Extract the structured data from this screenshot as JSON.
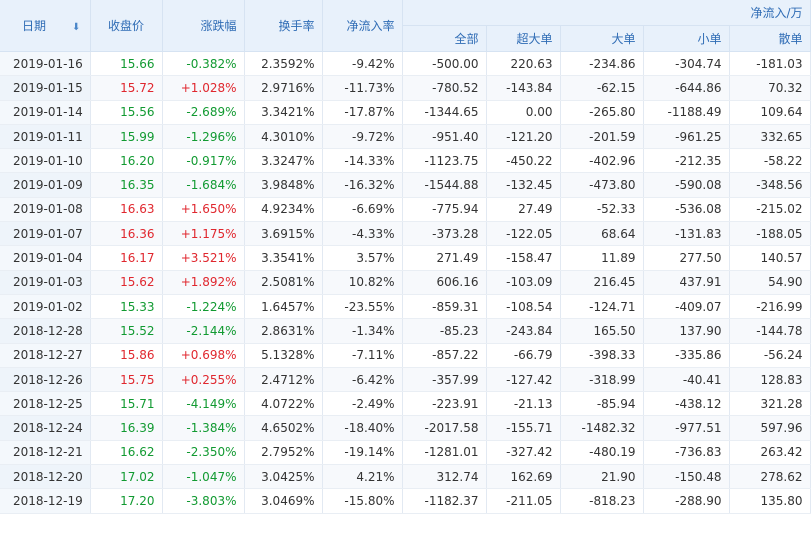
{
  "headers": {
    "date": "日期",
    "close": "收盘价",
    "change": "涨跌幅",
    "turnover": "换手率",
    "net_rate": "净流入率",
    "net_group": "净流入/万",
    "total": "全部",
    "super_large": "超大单",
    "large": "大单",
    "small": "小单",
    "retail": "散单",
    "sort_icon": "arrow-down-icon"
  },
  "colors": {
    "up": "#e0272e",
    "down": "#119a31",
    "header_bg": "#e8f1fb",
    "header_text": "#2f6cb5"
  },
  "rows": [
    {
      "date": "2019-01-16",
      "close": "15.66",
      "change": "-0.382%",
      "turnover": "2.3592%",
      "net_rate": "-9.42%",
      "total": "-500.00",
      "super_large": "220.63",
      "large": "-234.86",
      "small": "-304.74",
      "retail": "-181.03",
      "dir": "down"
    },
    {
      "date": "2019-01-15",
      "close": "15.72",
      "change": "+1.028%",
      "turnover": "2.9716%",
      "net_rate": "-11.73%",
      "total": "-780.52",
      "super_large": "-143.84",
      "large": "-62.15",
      "small": "-644.86",
      "retail": "70.32",
      "dir": "up"
    },
    {
      "date": "2019-01-14",
      "close": "15.56",
      "change": "-2.689%",
      "turnover": "3.3421%",
      "net_rate": "-17.87%",
      "total": "-1344.65",
      "super_large": "0.00",
      "large": "-265.80",
      "small": "-1188.49",
      "retail": "109.64",
      "dir": "down"
    },
    {
      "date": "2019-01-11",
      "close": "15.99",
      "change": "-1.296%",
      "turnover": "4.3010%",
      "net_rate": "-9.72%",
      "total": "-951.40",
      "super_large": "-121.20",
      "large": "-201.59",
      "small": "-961.25",
      "retail": "332.65",
      "dir": "down"
    },
    {
      "date": "2019-01-10",
      "close": "16.20",
      "change": "-0.917%",
      "turnover": "3.3247%",
      "net_rate": "-14.33%",
      "total": "-1123.75",
      "super_large": "-450.22",
      "large": "-402.96",
      "small": "-212.35",
      "retail": "-58.22",
      "dir": "down"
    },
    {
      "date": "2019-01-09",
      "close": "16.35",
      "change": "-1.684%",
      "turnover": "3.9848%",
      "net_rate": "-16.32%",
      "total": "-1544.88",
      "super_large": "-132.45",
      "large": "-473.80",
      "small": "-590.08",
      "retail": "-348.56",
      "dir": "down"
    },
    {
      "date": "2019-01-08",
      "close": "16.63",
      "change": "+1.650%",
      "turnover": "4.9234%",
      "net_rate": "-6.69%",
      "total": "-775.94",
      "super_large": "27.49",
      "large": "-52.33",
      "small": "-536.08",
      "retail": "-215.02",
      "dir": "up"
    },
    {
      "date": "2019-01-07",
      "close": "16.36",
      "change": "+1.175%",
      "turnover": "3.6915%",
      "net_rate": "-4.33%",
      "total": "-373.28",
      "super_large": "-122.05",
      "large": "68.64",
      "small": "-131.83",
      "retail": "-188.05",
      "dir": "up"
    },
    {
      "date": "2019-01-04",
      "close": "16.17",
      "change": "+3.521%",
      "turnover": "3.3541%",
      "net_rate": "3.57%",
      "total": "271.49",
      "super_large": "-158.47",
      "large": "11.89",
      "small": "277.50",
      "retail": "140.57",
      "dir": "up"
    },
    {
      "date": "2019-01-03",
      "close": "15.62",
      "change": "+1.892%",
      "turnover": "2.5081%",
      "net_rate": "10.82%",
      "total": "606.16",
      "super_large": "-103.09",
      "large": "216.45",
      "small": "437.91",
      "retail": "54.90",
      "dir": "up"
    },
    {
      "date": "2019-01-02",
      "close": "15.33",
      "change": "-1.224%",
      "turnover": "1.6457%",
      "net_rate": "-23.55%",
      "total": "-859.31",
      "super_large": "-108.54",
      "large": "-124.71",
      "small": "-409.07",
      "retail": "-216.99",
      "dir": "down"
    },
    {
      "date": "2018-12-28",
      "close": "15.52",
      "change": "-2.144%",
      "turnover": "2.8631%",
      "net_rate": "-1.34%",
      "total": "-85.23",
      "super_large": "-243.84",
      "large": "165.50",
      "small": "137.90",
      "retail": "-144.78",
      "dir": "down"
    },
    {
      "date": "2018-12-27",
      "close": "15.86",
      "change": "+0.698%",
      "turnover": "5.1328%",
      "net_rate": "-7.11%",
      "total": "-857.22",
      "super_large": "-66.79",
      "large": "-398.33",
      "small": "-335.86",
      "retail": "-56.24",
      "dir": "up"
    },
    {
      "date": "2018-12-26",
      "close": "15.75",
      "change": "+0.255%",
      "turnover": "2.4712%",
      "net_rate": "-6.42%",
      "total": "-357.99",
      "super_large": "-127.42",
      "large": "-318.99",
      "small": "-40.41",
      "retail": "128.83",
      "dir": "up"
    },
    {
      "date": "2018-12-25",
      "close": "15.71",
      "change": "-4.149%",
      "turnover": "4.0722%",
      "net_rate": "-2.49%",
      "total": "-223.91",
      "super_large": "-21.13",
      "large": "-85.94",
      "small": "-438.12",
      "retail": "321.28",
      "dir": "down"
    },
    {
      "date": "2018-12-24",
      "close": "16.39",
      "change": "-1.384%",
      "turnover": "4.6502%",
      "net_rate": "-18.40%",
      "total": "-2017.58",
      "super_large": "-155.71",
      "large": "-1482.32",
      "small": "-977.51",
      "retail": "597.96",
      "dir": "down"
    },
    {
      "date": "2018-12-21",
      "close": "16.62",
      "change": "-2.350%",
      "turnover": "2.7952%",
      "net_rate": "-19.14%",
      "total": "-1281.01",
      "super_large": "-327.42",
      "large": "-480.19",
      "small": "-736.83",
      "retail": "263.42",
      "dir": "down"
    },
    {
      "date": "2018-12-20",
      "close": "17.02",
      "change": "-1.047%",
      "turnover": "3.0425%",
      "net_rate": "4.21%",
      "total": "312.74",
      "super_large": "162.69",
      "large": "21.90",
      "small": "-150.48",
      "retail": "278.62",
      "dir": "down"
    },
    {
      "date": "2018-12-19",
      "close": "17.20",
      "change": "-3.803%",
      "turnover": "3.0469%",
      "net_rate": "-15.80%",
      "total": "-1182.37",
      "super_large": "-211.05",
      "large": "-818.23",
      "small": "-288.90",
      "retail": "135.80",
      "dir": "down"
    }
  ]
}
